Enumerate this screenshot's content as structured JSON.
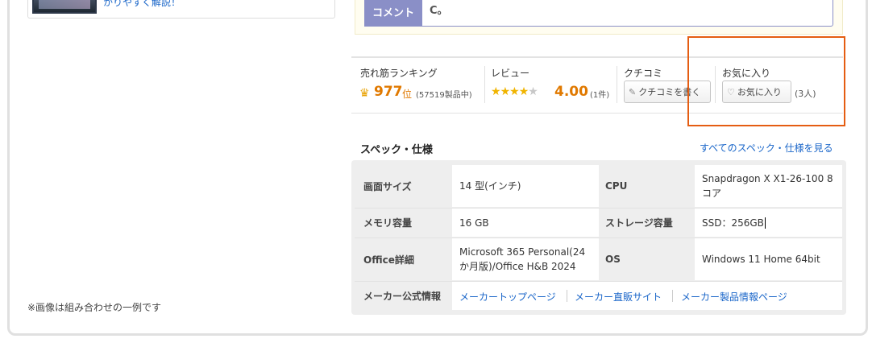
{
  "left": {
    "link_text": "かりやすく解説！",
    "footnote": "※画像は組み合わせの一例です"
  },
  "comment": {
    "label": "コメント",
    "text": "C。"
  },
  "stats": {
    "ranking": {
      "label": "売れ筋ランキング",
      "crown_icon": "crown-icon",
      "rank": "977",
      "unit": "位",
      "total": "(57519製品中)"
    },
    "review": {
      "label": "レビュー",
      "stars_filled": 4,
      "stars_total": 5,
      "score": "4.00",
      "count": "(1件)"
    },
    "kuchikomi": {
      "label": "クチコミ",
      "button": "クチコミを書く"
    },
    "favorite": {
      "label": "お気に入り",
      "button": "お気に入り",
      "count": "(3人)"
    }
  },
  "spec": {
    "title": "スペック・仕様",
    "all_link": "すべてのスペック・仕様を見る",
    "rows": [
      {
        "l1": "画面サイズ",
        "v1": "14 型(インチ)",
        "l2": "CPU",
        "v2": "Snapdragon X X1-26-100 8コア"
      },
      {
        "l1": "メモリ容量",
        "v1": "16 GB",
        "l2": "ストレージ容量",
        "v2": "SSD：256GB"
      },
      {
        "l1": "Office詳細",
        "v1": "Microsoft 365 Personal(24か月版)/Office H&B 2024",
        "l2": "OS",
        "v2": "Windows 11 Home 64bit"
      }
    ],
    "maker": {
      "label": "メーカー公式情報",
      "links": [
        "メーカートップページ",
        "メーカー直販サイト",
        "メーカー製品情報ページ"
      ]
    }
  },
  "colors": {
    "accent_orange": "#e07900",
    "link_blue": "#1a66c9",
    "highlight": "#e55d12",
    "comment_label_bg": "#8a8fc7"
  }
}
